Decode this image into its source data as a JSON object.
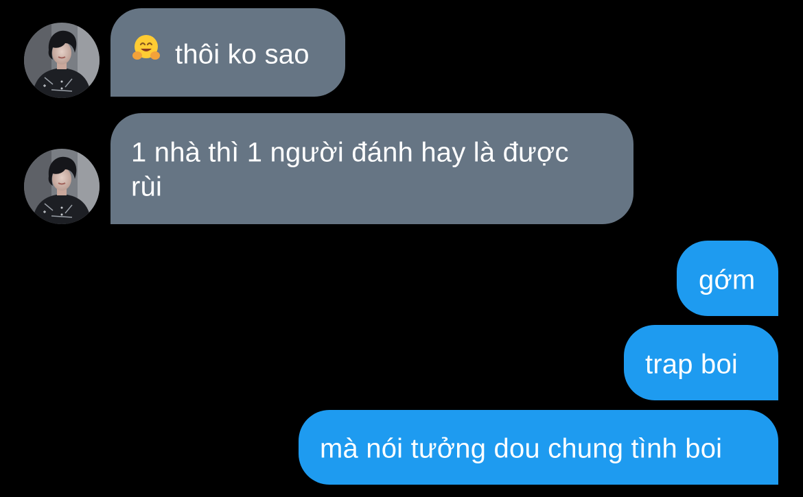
{
  "conversation": {
    "contact": {
      "avatar": "profile-photo-dark-hair-dark-jacket"
    },
    "messages": [
      {
        "direction": "incoming",
        "emoji": "hugging-face",
        "text": "thôi ko sao"
      },
      {
        "direction": "incoming",
        "text": "1 nhà thì 1 người đánh hay là được rùi"
      },
      {
        "direction": "outgoing",
        "text": "gớm"
      },
      {
        "direction": "outgoing",
        "text": "trap boi"
      },
      {
        "direction": "outgoing",
        "text": "mà nói tưởng dou chung tình boi"
      }
    ]
  },
  "colors": {
    "background": "#000000",
    "incoming_bubble": "#667584",
    "outgoing_bubble": "#1e9bf0",
    "text": "#ffffff"
  }
}
